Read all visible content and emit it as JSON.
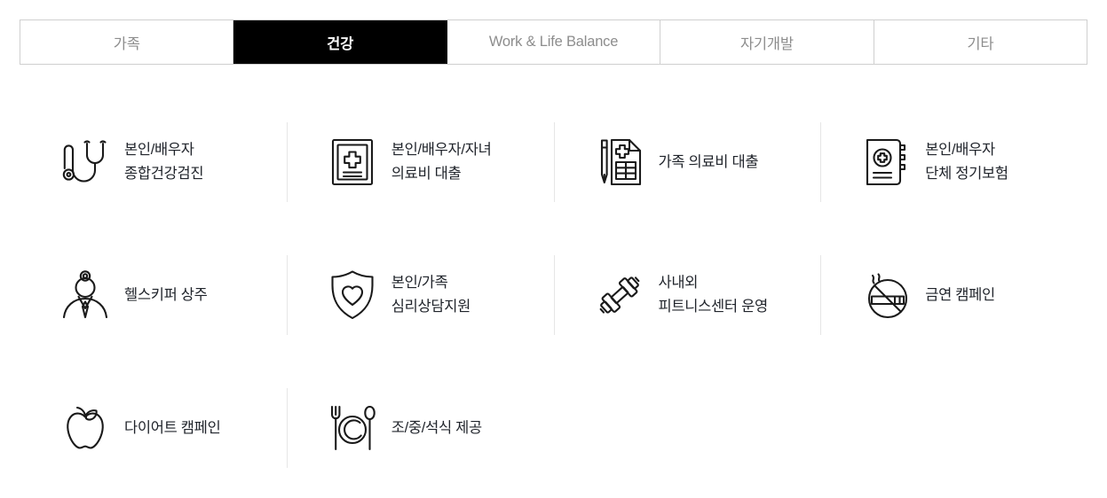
{
  "tabs": [
    {
      "label": "가족",
      "active": false,
      "name": "tab-family"
    },
    {
      "label": "건강",
      "active": true,
      "name": "tab-health"
    },
    {
      "label": "Work & Life Balance",
      "active": false,
      "name": "tab-work-life-balance"
    },
    {
      "label": "자기개발",
      "active": false,
      "name": "tab-self-development"
    },
    {
      "label": "기타",
      "active": false,
      "name": "tab-etc"
    }
  ],
  "colors": {
    "active_tab_bg": "#000000",
    "active_tab_text": "#ffffff",
    "inactive_tab_text": "#8d8d8d",
    "tab_border": "#cfcfcf",
    "divider": "#e6e6e6",
    "label_text": "#20242b",
    "icon_stroke": "#1a1a1a",
    "page_bg": "#ffffff"
  },
  "benefits": [
    {
      "icon": "stethoscope-icon",
      "label": "본인/배우자\n종합건강검진"
    },
    {
      "icon": "medical-record-icon",
      "label": "본인/배우자/자녀\n의료비 대출"
    },
    {
      "icon": "medical-form-pen-icon",
      "label": "가족 의료비 대출"
    },
    {
      "icon": "insurance-book-icon",
      "label": "본인/배우자\n단체 정기보험"
    },
    {
      "icon": "doctor-icon",
      "label": "헬스키퍼 상주"
    },
    {
      "icon": "shield-heart-icon",
      "label": "본인/가족\n심리상담지원"
    },
    {
      "icon": "dumbbell-icon",
      "label": "사내외\n피트니스센터 운영"
    },
    {
      "icon": "no-smoking-icon",
      "label": "금연 캠페인"
    },
    {
      "icon": "apple-icon",
      "label": "다이어트 캠페인"
    },
    {
      "icon": "cutlery-plate-icon",
      "label": "조/중/석식 제공"
    }
  ]
}
